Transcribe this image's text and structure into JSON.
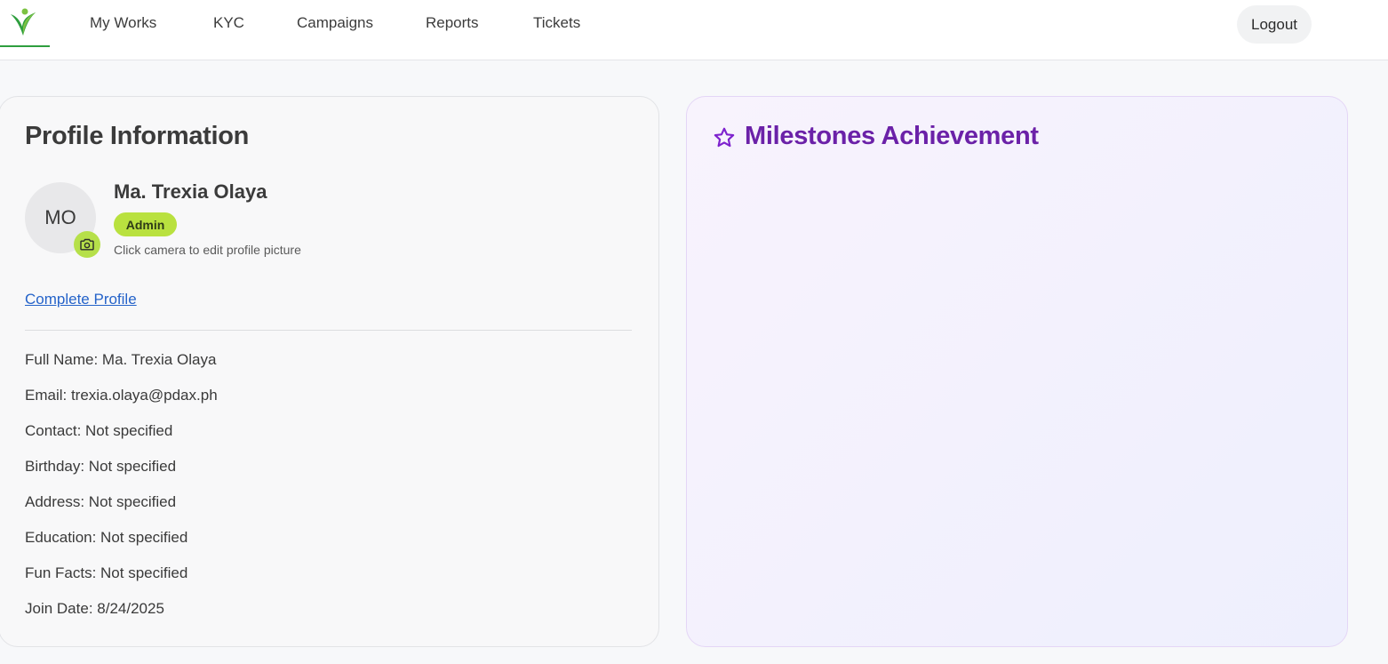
{
  "nav": {
    "items": [
      {
        "label": "My Works"
      },
      {
        "label": "KYC"
      },
      {
        "label": "Campaigns"
      },
      {
        "label": "Reports"
      },
      {
        "label": "Tickets"
      }
    ],
    "logout_label": "Logout"
  },
  "profile": {
    "title": "Profile Information",
    "initials": "MO",
    "name": "Ma. Trexia Olaya",
    "role": "Admin",
    "camera_hint": "Click camera to edit profile picture",
    "complete_link": "Complete Profile",
    "fields": [
      {
        "text": "Full Name: Ma. Trexia Olaya"
      },
      {
        "text": "Email: trexia.olaya@pdax.ph"
      },
      {
        "text": "Contact: Not specified"
      },
      {
        "text": "Birthday: Not specified"
      },
      {
        "text": "Address: Not specified"
      },
      {
        "text": "Education: Not specified"
      },
      {
        "text": "Fun Facts: Not specified"
      },
      {
        "text": "Join Date: 8/24/2025"
      }
    ]
  },
  "milestones": {
    "title": "Milestones Achievement"
  },
  "colors": {
    "accent_green": "#b9e13f",
    "brand_green": "#2e9e3e",
    "milestone_purple": "#6b21a8",
    "link_blue": "#2563c9"
  },
  "icons": {
    "logo": "person-leaf-logo",
    "camera": "camera-icon",
    "star": "star-icon"
  }
}
